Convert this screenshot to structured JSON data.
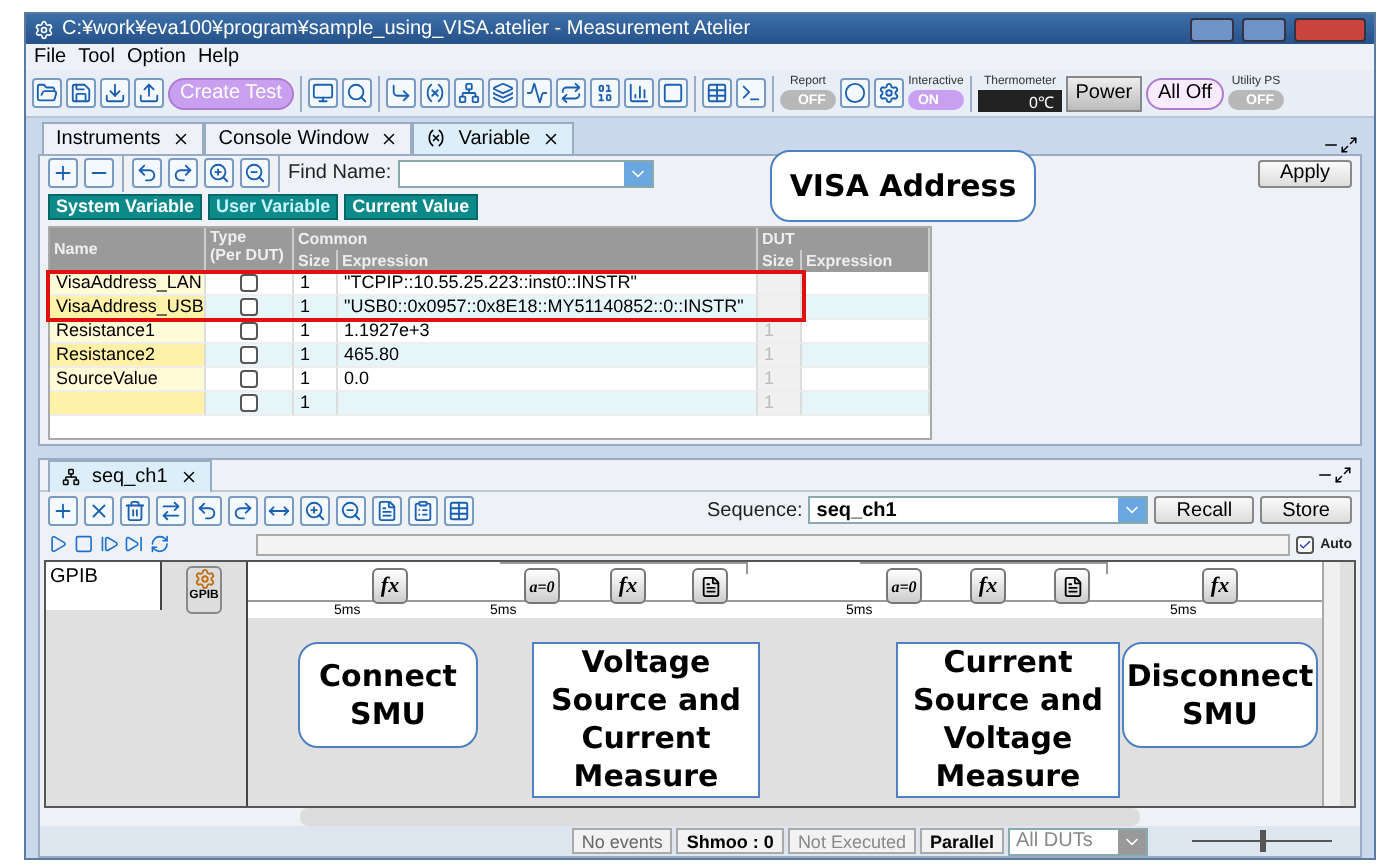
{
  "window": {
    "title": "C:¥work¥eva100¥program¥sample_using_VISA.atelier - Measurement Atelier"
  },
  "menu": [
    "File",
    "Tool",
    "Option",
    "Help"
  ],
  "toolbar": {
    "create_test": "Create Test",
    "report": {
      "label": "Report",
      "on": false,
      "state_text": "OFF"
    },
    "interactive": {
      "label": "Interactive",
      "on": true,
      "state_text": "ON"
    },
    "thermometer": {
      "label": "Thermometer",
      "value": "0℃"
    },
    "power": "Power",
    "all_off": "All Off",
    "utility_ps": {
      "label": "Utility PS",
      "on": false,
      "state_text": "OFF"
    }
  },
  "tabs": [
    {
      "label": "Instruments",
      "selected": false
    },
    {
      "label": "Console Window",
      "selected": false
    },
    {
      "label": "Variable",
      "selected": true
    }
  ],
  "variable_panel": {
    "find_label": "Find Name:",
    "apply": "Apply",
    "subtabs": [
      {
        "label": "System Variable",
        "selected": false
      },
      {
        "label": "User Variable",
        "selected": true
      },
      {
        "label": "Current Value",
        "selected": false
      }
    ],
    "headers": {
      "name": "Name",
      "type": "Type",
      "type_sub": "(Per DUT)",
      "common": "Common",
      "size": "Size",
      "expression": "Expression",
      "dut": "DUT",
      "dut_size": "Size",
      "dut_expression": "Expression"
    },
    "rows": [
      {
        "name": "VisaAddress_LAN",
        "per_dut": false,
        "size": "1",
        "expression": "\"TCPIP::10.55.25.223::inst0::INSTR\""
      },
      {
        "name": "VisaAddress_USB",
        "per_dut": false,
        "size": "1",
        "expression": "\"USB0::0x0957::0x8E18::MY51140852::0::INSTR\""
      },
      {
        "name": "Resistance1",
        "per_dut": false,
        "size": "1",
        "expression": "1.1927e+3",
        "dut_size": "1"
      },
      {
        "name": "Resistance2",
        "per_dut": false,
        "size": "1",
        "expression": "465.80",
        "dut_size": "1"
      },
      {
        "name": "SourceValue",
        "per_dut": false,
        "size": "1",
        "expression": "0.0",
        "dut_size": "1"
      },
      {
        "name": "",
        "per_dut": false,
        "size": "1",
        "expression": "",
        "dut_size": "1"
      }
    ]
  },
  "sequence_panel": {
    "tab": "seq_ch1",
    "sequence_label": "Sequence:",
    "sequence_value": "seq_ch1",
    "recall": "Recall",
    "store": "Store",
    "auto_checked": true,
    "auto_label": "Auto",
    "lane": {
      "name": "GPIB",
      "device_label": "GPIB"
    },
    "steps": [
      {
        "kind": "fx",
        "glyph": "fx"
      },
      {
        "kind": "assign",
        "glyph": "a=0"
      },
      {
        "kind": "fx",
        "glyph": "fx"
      },
      {
        "kind": "print"
      },
      {
        "kind": "assign",
        "glyph": "a=0"
      },
      {
        "kind": "fx",
        "glyph": "fx"
      },
      {
        "kind": "print"
      },
      {
        "kind": "fx",
        "glyph": "fx"
      }
    ],
    "delays": [
      "5ms",
      "5ms",
      "5ms",
      "5ms"
    ]
  },
  "callouts": [
    {
      "kind": "bubble",
      "text": "VISA Address"
    },
    {
      "kind": "bubble",
      "text": "Connect SMU"
    },
    {
      "kind": "box",
      "text": "Voltage Source and Current Measure"
    },
    {
      "kind": "box",
      "text": "Current Source and Voltage Measure"
    },
    {
      "kind": "bubble",
      "text": "Disconnect SMU"
    }
  ],
  "status_bar": {
    "events": "No events",
    "shmoo": "Shmoo : 0",
    "execution": "Not Executed",
    "mode": "Parallel",
    "duts": "All DUTs",
    "zoom_slider": {
      "level": 0.5
    }
  }
}
